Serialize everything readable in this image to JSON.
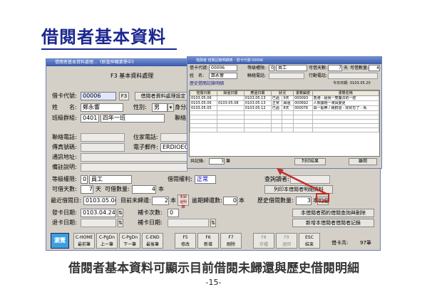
{
  "slide": {
    "title": "借閱者基本資料",
    "caption": "借閱者基本資料可顯示目前借閱未歸還與歷史借閱明細",
    "page": "-15-"
  },
  "main_window": {
    "title": "借閱者基本資料處理...《新聖伸職業學中》",
    "heading": "F3  基本資料處理",
    "borrower_id_label": "借卡代號:",
    "borrower_id": "00006",
    "f3_tag": "F3",
    "setup_button": "借閱者資料處理設定",
    "name_label": "姓　　名:",
    "name": "鄭永響",
    "gender_label": "性別:",
    "gender": "男",
    "id_no_label": "身分證",
    "class_label": "班級群組:",
    "class_code": "0401",
    "class_name": "四年一班",
    "contact_label": "聯絡方",
    "phone_label": "聯絡電話:",
    "fax_label": "傳真號碼:",
    "address_label": "通訊地址:",
    "note_label": "備註說明:",
    "home_phone_label": "住家電話:",
    "mobile_label": "行動電話:",
    "email_label": "電子郵件:",
    "email": "ERDIOECO",
    "level_label": "等級權限:",
    "level_code": "0",
    "level_name": "員工",
    "right_label": "借閱權利:",
    "right_value": "正常",
    "query_label": "查詢讀者:",
    "days_label": "可借天數:",
    "days": "7",
    "days_unit": "天",
    "qty_label": "可借數量:",
    "qty": "4",
    "qty_unit": "本",
    "last_date_label": "最近借閱日:",
    "last_date": "0103.05.06",
    "unreturned_label": "目前未歸還:",
    "unreturned": "2",
    "unit": "本",
    "overdue_tag": "未歸還明細",
    "overdue_label": "逾期歸還數:",
    "overdue": "0",
    "overdue_unit": "本",
    "history_label": "歷史借閱數量:",
    "history": "3",
    "history_unit": "本",
    "history_button": "明細",
    "print_button": "列印本借閱者明細資料",
    "issue_date_label": "發卡日期:",
    "issue_date": "0103.04.24",
    "reissue_label": "補卡次數:",
    "reissue": "0",
    "expire_label": "退卡日期:",
    "reissue_date_label": "補卡日期:",
    "delete_button": "本借閱者預約借閱查詢與刪除",
    "add_button": "新增本借閱者借閱者記錄",
    "toolbar": [
      {
        "key": "C-HOME",
        "label": "最前筆"
      },
      {
        "key": "C-PgDn",
        "label": "上一筆"
      },
      {
        "key": "C-PgDn",
        "label": "下一筆"
      },
      {
        "key": "C-END",
        "label": "最後筆"
      },
      {
        "key": "F5",
        "label": "修改"
      },
      {
        "key": "F6",
        "label": "新增"
      },
      {
        "key": "F7",
        "label": "刪除"
      },
      {
        "key": "F8",
        "label": "存檔"
      },
      {
        "key": "F9",
        "label": "退回"
      },
      {
        "key": "ESC",
        "label": "結束"
      }
    ],
    "browse_button": "瀏覽",
    "count_label": "借卡共:",
    "count": "97筆"
  },
  "detail_window": {
    "title": "借閱者 借閱記錄明細表  - 借卡代號 00006",
    "card_label": "借卡代號:",
    "card": "00006",
    "level_label": "等級權限:",
    "level_code": "0",
    "level_name": "員工",
    "days_label": "可借天數:",
    "days": "7",
    "days_unit": "天",
    "qty_label": "可借數量:",
    "qty": "4",
    "name_label": "姓　名:",
    "name": "鄭永響",
    "phone_label": "聯絡電話:",
    "mobile_label": "行動電話:",
    "section_label": "歷史借閱記錄明細",
    "today_label": "今日日期:",
    "today": "0103.05.20",
    "columns": [
      "借閱日期",
      "歸還日期",
      "應還日期",
      "狀況",
      "書籍編號",
      "書籍名稱"
    ],
    "rows": [
      [
        "0103.05.06",
        "",
        "0103.05.13",
        "已過",
        "9天",
        "000093",
        "香港 - 給我一雙魔法的一腔"
      ],
      [
        "0103.05.06",
        "0103.05.08",
        "0103.05.13",
        "正常",
        "歸還",
        "000692",
        "人類議題一演員變更"
      ],
      [
        "0103.05.05",
        "",
        "0103.05.12",
        "已過",
        "8天",
        "000076",
        "與一般無 / 線群發 - 好好忘了 - 馬"
      ]
    ],
    "total_label": "共記錄:",
    "total": "3",
    "total_unit": "筆",
    "print_button": "列印結果",
    "close_button": "離開"
  }
}
